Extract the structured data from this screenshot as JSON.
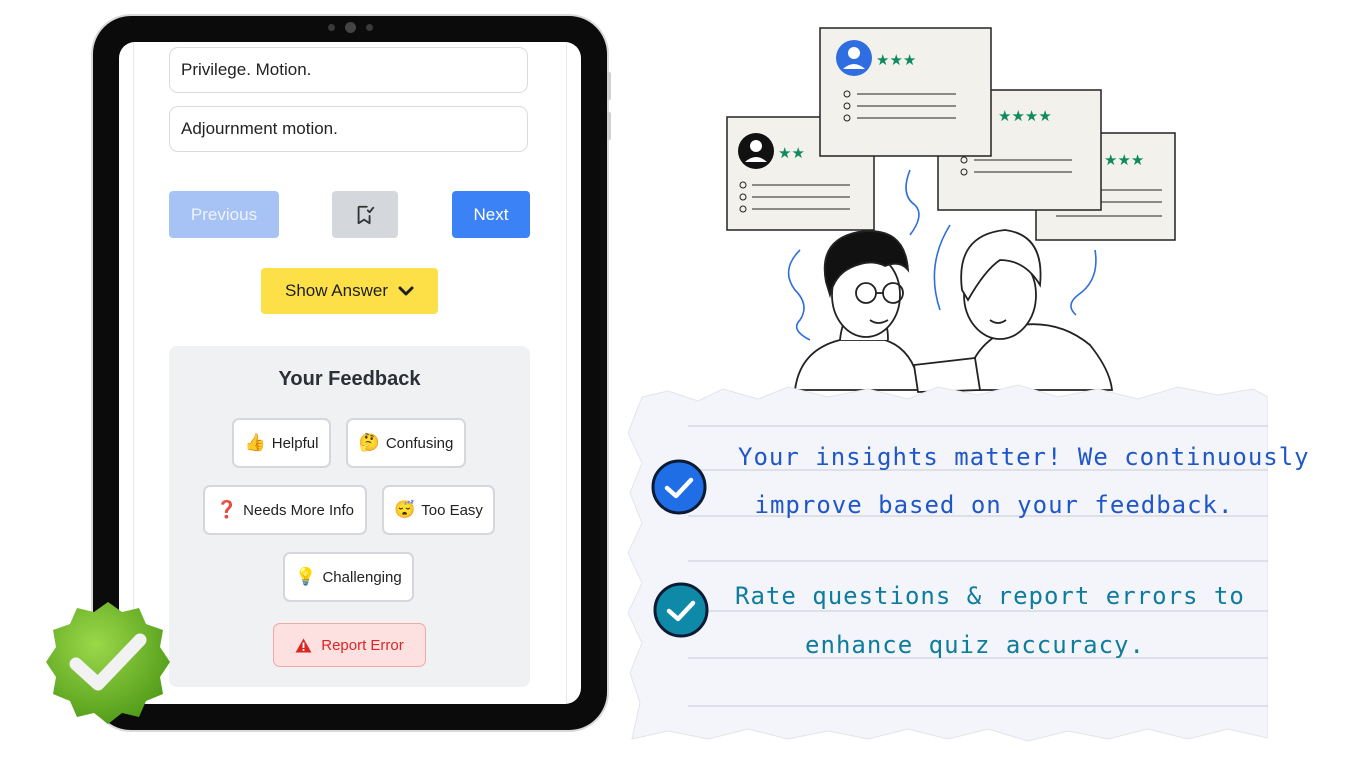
{
  "quiz": {
    "options": [
      "Privilege. Motion.",
      "Adjournment motion."
    ],
    "nav": {
      "previous": "Previous",
      "next": "Next",
      "bookmark_icon": "bookmark-check-icon"
    },
    "show_answer": "Show Answer",
    "feedback": {
      "title": "Your Feedback",
      "chips": [
        {
          "emoji": "👍",
          "label": "Helpful"
        },
        {
          "emoji": "🤔",
          "label": "Confusing"
        },
        {
          "emoji": "❓",
          "label": "Needs More Info"
        },
        {
          "emoji": "😴",
          "label": "Too Easy"
        },
        {
          "emoji": "💡",
          "label": "Challenging"
        }
      ],
      "report": "Report Error"
    }
  },
  "notes": {
    "line1a": "Your insights matter! We continuously",
    "line1b": "improve based on your feedback.",
    "line2a": "Rate questions & report errors to",
    "line2b": "enhance quiz accuracy."
  },
  "colors": {
    "primary": "#3b82f6",
    "warning": "#fde047",
    "danger": "#dc2626",
    "success_badge": "#7cbf2a",
    "star": "#0f8a5f"
  }
}
